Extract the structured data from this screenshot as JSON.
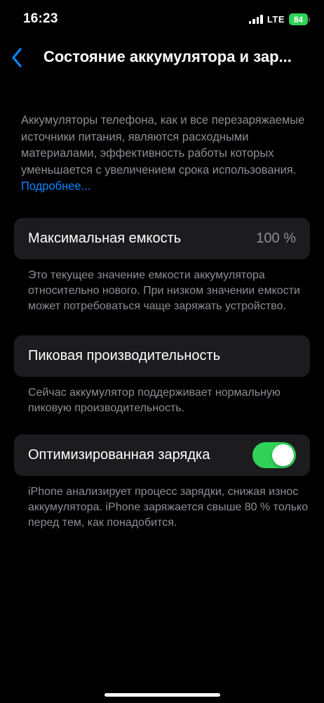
{
  "status_bar": {
    "time": "16:23",
    "network": "LTE",
    "battery": "84"
  },
  "nav": {
    "back_icon": "chevron-left-icon",
    "title": "Состояние аккумулятора и зар..."
  },
  "intro": {
    "text": "Аккумуляторы телефона, как и все перезаряжаемые источники питания, являются расходными материалами, эффективность работы которых уменьшается с увеличением срока использования. ",
    "link": "Подробнее..."
  },
  "max_capacity": {
    "label": "Максимальная емкость",
    "value": "100 %",
    "footnote": "Это текущее значение емкости аккумулятора относительно нового. При низком значении емкости может потребоваться чаще заряжать устройство."
  },
  "peak_performance": {
    "label": "Пиковая производительность",
    "footnote": "Сейчас аккумулятор поддерживает нормальную пиковую производительность."
  },
  "optimized_charging": {
    "label": "Оптимизированная зарядка",
    "enabled": true,
    "footnote": "iPhone анализирует процесс зарядки, снижая износ аккумулятора. iPhone заряжается свыше 80 % только перед тем, как понадобится."
  },
  "colors": {
    "accent": "#0a84ff",
    "toggle_on": "#30d158",
    "cell_bg": "#1c1c1e",
    "secondary_text": "#8e8e93"
  }
}
